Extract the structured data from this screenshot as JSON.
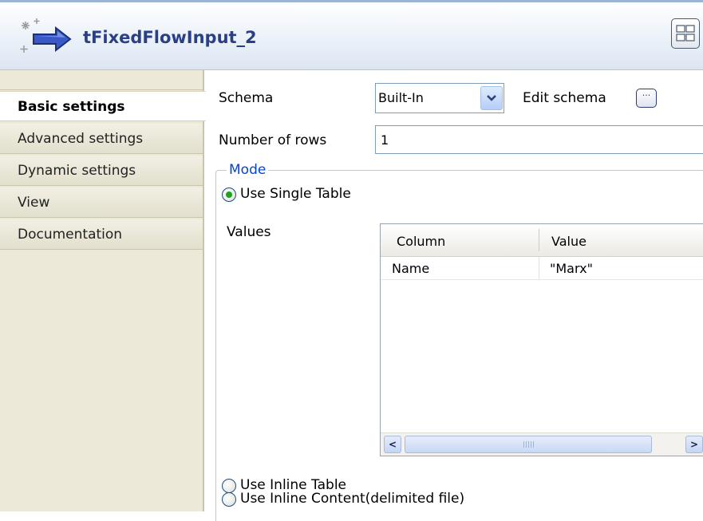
{
  "header": {
    "title": "tFixedFlowInput_2"
  },
  "tabs": [
    {
      "label": "Basic settings",
      "active": true
    },
    {
      "label": "Advanced settings",
      "active": false
    },
    {
      "label": "Dynamic settings",
      "active": false
    },
    {
      "label": "View",
      "active": false
    },
    {
      "label": "Documentation",
      "active": false
    }
  ],
  "form": {
    "schema_label": "Schema",
    "schema_value": "Built-In",
    "edit_schema_label": "Edit schema",
    "edit_schema_button": "···",
    "rows_label": "Number of rows",
    "rows_value": "1",
    "mode_legend": "Mode",
    "use_single_table": "Use Single Table",
    "values_label": "Values",
    "use_inline_table": "Use Inline Table",
    "use_inline_content": "Use Inline Content(delimited file)",
    "selected_mode": "Use Single Table"
  },
  "values_table": {
    "columns": [
      "Column",
      "Value"
    ],
    "rows": [
      [
        "Name",
        "\"Marx\""
      ]
    ]
  },
  "colors": {
    "title": "#2a3f86",
    "legend": "#0046d5",
    "tab_bg": "#ece9d8"
  }
}
